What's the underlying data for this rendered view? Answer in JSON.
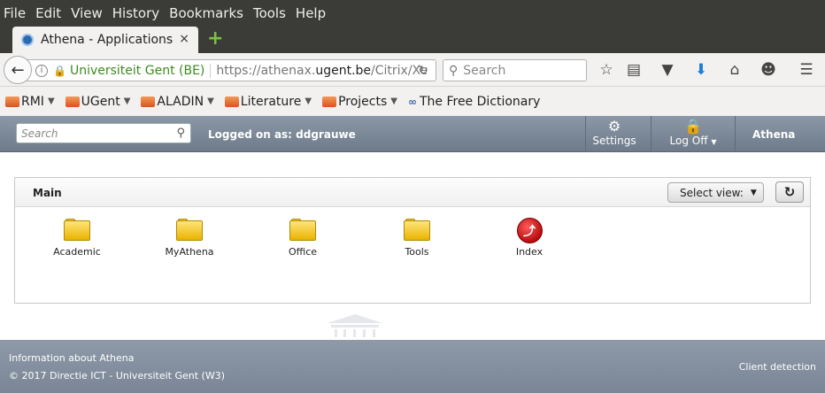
{
  "menubar": {
    "items": [
      "File",
      "Edit",
      "View",
      "History",
      "Bookmarks",
      "Tools",
      "Help"
    ]
  },
  "tab": {
    "title": "Athena - Applications",
    "close": "×",
    "new_tab": "+"
  },
  "navbar": {
    "identity": "Universiteit Gent (BE)",
    "url_prefix": "https://athenax.",
    "url_domain": "ugent.be",
    "url_path": "/Citrix/Xe",
    "search_placeholder": "Search"
  },
  "bookmarks": [
    {
      "label": "RMI",
      "has_menu": true
    },
    {
      "label": "UGent",
      "has_menu": true
    },
    {
      "label": "ALADIN",
      "has_menu": true
    },
    {
      "label": "Literature",
      "has_menu": true
    },
    {
      "label": "Projects",
      "has_menu": true
    },
    {
      "label": "The Free Dictionary",
      "has_menu": false
    }
  ],
  "athena_header": {
    "search_placeholder": "Search",
    "logged_on": "Logged on as: ddgrauwe",
    "settings": "Settings",
    "logoff": "Log Off",
    "site_name": "Athena"
  },
  "panel": {
    "title": "Main",
    "select_view": "Select view:",
    "apps": [
      {
        "label": "Academic",
        "icon": "folder-icon"
      },
      {
        "label": "MyAthena",
        "icon": "folder-icon"
      },
      {
        "label": "Office",
        "icon": "folder-icon"
      },
      {
        "label": "Tools",
        "icon": "folder-icon"
      },
      {
        "label": "Index",
        "icon": "index-app-icon"
      }
    ]
  },
  "footer": {
    "info": "Information about Athena",
    "copyright": "© 2017 Directie ICT - Universiteit Gent (W3)",
    "client_detection": "Client detection"
  },
  "colors": {
    "header": "#7a8696",
    "accent_green": "#3d8a1f",
    "index_red": "#c8171c"
  }
}
